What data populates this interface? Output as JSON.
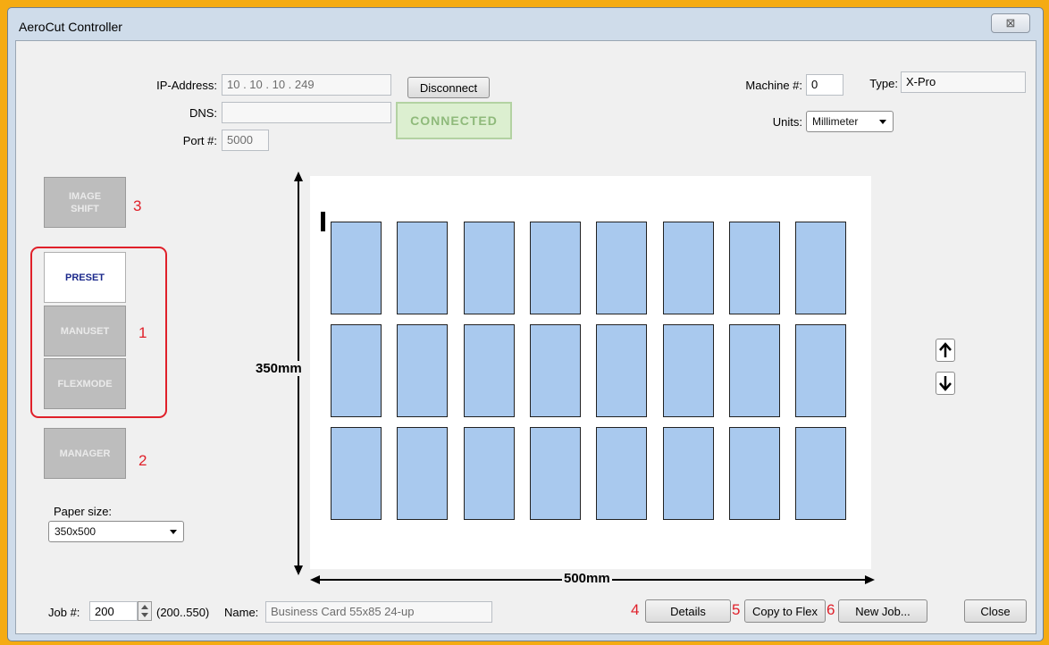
{
  "window": {
    "title": "AeroCut Controller",
    "close_glyph": "⊠"
  },
  "connection": {
    "ip_label": "IP-Address:",
    "ip_value": "10  .  10  .  10  . 249",
    "dns_label": "DNS:",
    "dns_value": "",
    "port_label": "Port #:",
    "port_value": "5000",
    "disconnect_label": "Disconnect",
    "status": "CONNECTED"
  },
  "machine": {
    "machine_label": "Machine #:",
    "machine_value": "0",
    "type_label": "Type:",
    "type_value": "X-Pro",
    "units_label": "Units:",
    "units_value": "Millimeter"
  },
  "modes": {
    "image_shift": "IMAGE\nSHIFT",
    "preset": "PRESET",
    "manuset": "MANUSET",
    "flexmode": "FLEXMODE",
    "manager": "MANAGER"
  },
  "annotations": {
    "n1": "1",
    "n2": "2",
    "n3": "3",
    "n4": "4",
    "n5": "5",
    "n6": "6"
  },
  "paper": {
    "label": "Paper size:",
    "value": "350x500"
  },
  "layout": {
    "height_label": "350mm",
    "width_label": "500mm",
    "rows": 3,
    "cols": 8
  },
  "job": {
    "job_label": "Job #:",
    "job_value": "200",
    "range": "(200..550)",
    "name_label": "Name:",
    "name_value": "Business Card 55x85 24-up"
  },
  "buttons": {
    "details": "Details",
    "copy_to_flex": "Copy to Flex",
    "new_job": "New Job...",
    "close": "Close"
  },
  "colors": {
    "accent_red": "#e0202a",
    "card_fill": "#a9c9ee",
    "connected_green": "#8fba7b"
  }
}
